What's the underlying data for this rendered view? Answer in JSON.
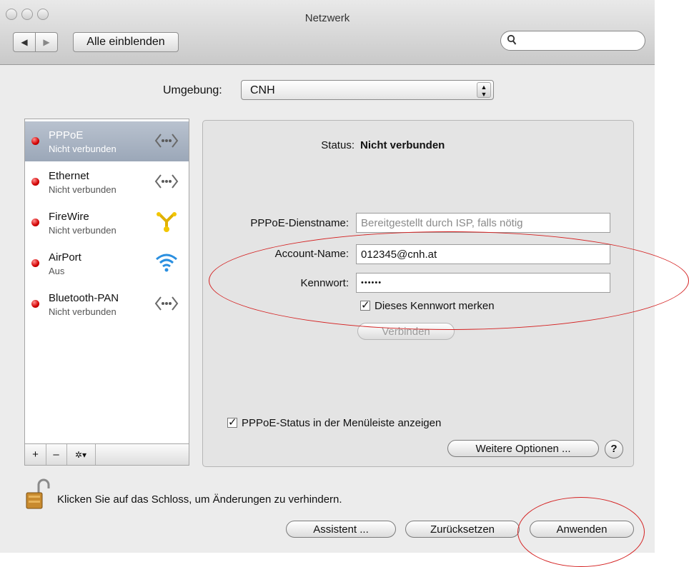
{
  "window": {
    "title": "Netzwerk"
  },
  "toolbar": {
    "back_icon": "◀",
    "forward_icon": "▶",
    "show_all_label": "Alle einblenden",
    "search_value": "",
    "search_icon": "magnifying-glass"
  },
  "location": {
    "label": "Umgebung:",
    "value": "CNH"
  },
  "services": [
    {
      "name": "PPPoE",
      "status": "Nicht verbunden",
      "state": "red",
      "icon": "bracket-dots-icon",
      "selected": true
    },
    {
      "name": "Ethernet",
      "status": "Nicht verbunden",
      "state": "red",
      "icon": "bracket-dots-icon",
      "selected": false
    },
    {
      "name": "FireWire",
      "status": "Nicht verbunden",
      "state": "red",
      "icon": "firewire-icon",
      "selected": false
    },
    {
      "name": "AirPort",
      "status": "Aus",
      "state": "red",
      "icon": "wifi-icon",
      "selected": false
    },
    {
      "name": "Bluetooth-PAN",
      "status": "Nicht verbunden",
      "state": "red",
      "icon": "bracket-dots-icon",
      "selected": false
    }
  ],
  "list_toolbar": {
    "add": "+",
    "remove": "–",
    "action": "✲▾"
  },
  "detail": {
    "status_label": "Status:",
    "status_value": "Nicht verbunden",
    "service_name_label": "PPPoE-Dienstname:",
    "service_name_placeholder": "Bereitgestellt durch ISP, falls nötig",
    "account_label": "Account-Name:",
    "account_value": "012345@cnh.at",
    "password_label": "Kennwort:",
    "password_value": "••••••",
    "remember_label": "Dieses Kennwort merken",
    "remember_checked": true,
    "connect_label": "Verbinden",
    "menubar_label": "PPPoE-Status in der Menüleiste anzeigen",
    "menubar_checked": true,
    "advanced_label": "Weitere Optionen ...",
    "help_label": "?"
  },
  "footer": {
    "lock_text": "Klicken Sie auf das Schloss, um Änderungen zu verhindern.",
    "assistant_label": "Assistent ...",
    "revert_label": "Zurücksetzen",
    "apply_label": "Anwenden"
  },
  "colors": {
    "annotation_red": "#d42020",
    "status_red": "#d20000",
    "selection": "#9ba7b8"
  }
}
